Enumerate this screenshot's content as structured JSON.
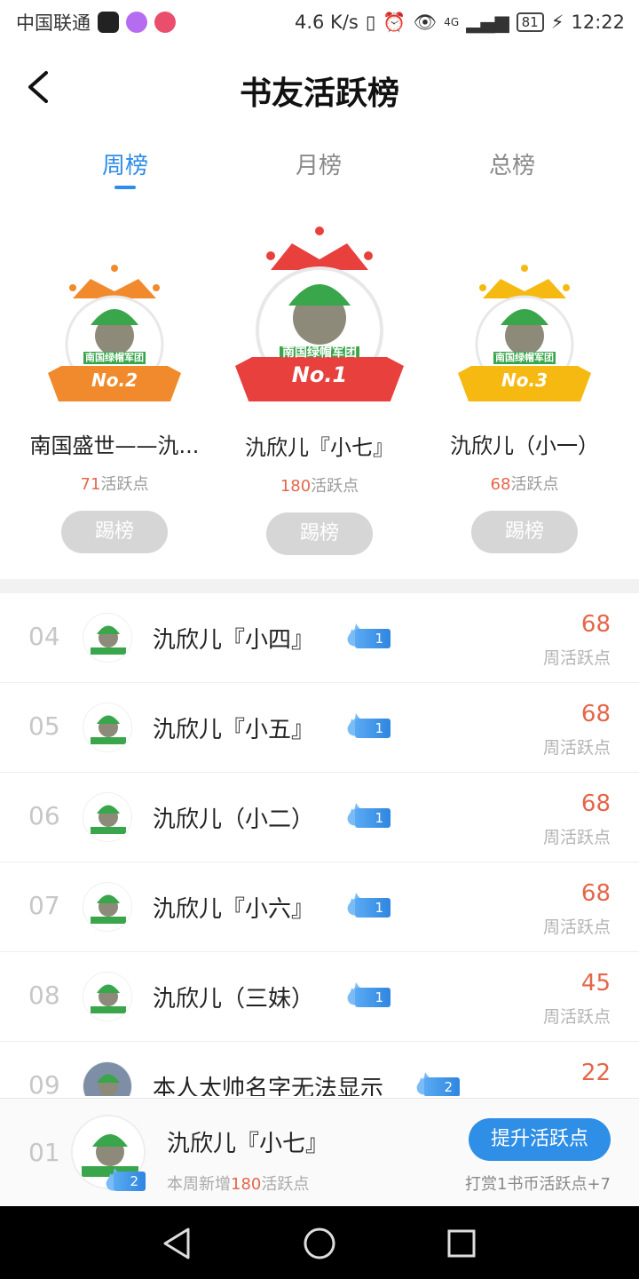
{
  "status_bar": {
    "carrier": "中国联通",
    "speed": "4.6 K/s",
    "network": "4G",
    "battery": "81",
    "time": "12:22"
  },
  "header": {
    "title": "书友活跃榜"
  },
  "tabs": [
    {
      "label": "周榜",
      "active": true
    },
    {
      "label": "月榜",
      "active": false
    },
    {
      "label": "总榜",
      "active": false
    }
  ],
  "podium": {
    "first": {
      "badge": "No.1",
      "name": "氿欣儿『小七』",
      "points": "180",
      "points_suffix": "活跃点",
      "button": "踢榜",
      "group_text": "南国绿帽军团",
      "sub_text": "氿欣儿"
    },
    "second": {
      "badge": "No.2",
      "name": "南国盛世——氿...",
      "points": "71",
      "points_suffix": "活跃点",
      "button": "踢榜",
      "group_text": "南国绿帽军团",
      "sub_text": "氿欣儿"
    },
    "third": {
      "badge": "No.3",
      "name": "氿欣儿（小一）",
      "points": "68",
      "points_suffix": "活跃点",
      "button": "踢榜",
      "group_text": "南国绿帽军团",
      "sub_text": "氿欣儿"
    }
  },
  "list": [
    {
      "rank": "04",
      "name": "氿欣儿『小四』",
      "level": "1",
      "value": "68",
      "label": "周活跃点"
    },
    {
      "rank": "05",
      "name": "氿欣儿『小五』",
      "level": "1",
      "value": "68",
      "label": "周活跃点"
    },
    {
      "rank": "06",
      "name": "氿欣儿（小二）",
      "level": "1",
      "value": "68",
      "label": "周活跃点"
    },
    {
      "rank": "07",
      "name": "氿欣儿『小六』",
      "level": "1",
      "value": "68",
      "label": "周活跃点"
    },
    {
      "rank": "08",
      "name": "氿欣儿（三妹）",
      "level": "1",
      "value": "45",
      "label": "周活跃点"
    },
    {
      "rank": "09",
      "name": "本人太帅名字无法显示",
      "level": "2",
      "value": "22",
      "label": "周活跃点"
    }
  ],
  "me": {
    "rank": "01",
    "name": "氿欣儿『小七』",
    "level": "2",
    "sub_prefix": "本周新增",
    "sub_value": "180",
    "sub_suffix": "活跃点",
    "boost_button": "提升活跃点",
    "tip": "打赏1书币活跃点+7"
  },
  "colors": {
    "accent": "#2e8de6",
    "points_red": "#e5664a",
    "gold_first": "#e8403c",
    "silver_second": "#f08a2c",
    "bronze_third": "#f5b912"
  }
}
